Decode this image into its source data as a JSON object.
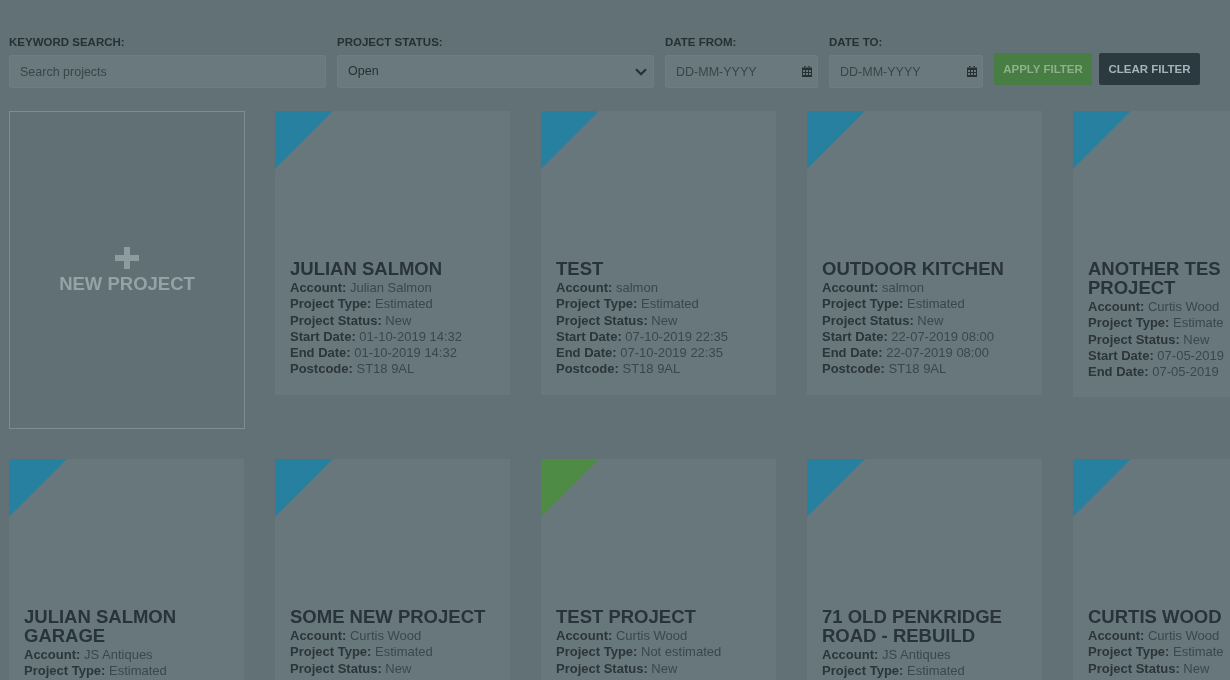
{
  "filters": {
    "keyword": {
      "label": "KEYWORD SEARCH:",
      "placeholder": "Search projects"
    },
    "status": {
      "label": "PROJECT STATUS:",
      "value": "Open"
    },
    "date_from": {
      "label": "DATE FROM:",
      "placeholder": "DD-MM-YYYY"
    },
    "date_to": {
      "label": "DATE TO:",
      "placeholder": "DD-MM-YYYY"
    },
    "buttons": [
      {
        "label": "APPLY FILTER",
        "kind": "apply"
      },
      {
        "label": "CLEAR FILTER",
        "kind": "clear"
      }
    ]
  },
  "new_project": {
    "label": "NEW PROJECT"
  },
  "projects": [
    {
      "title": "JULIAN SALMON",
      "color": "#27809f",
      "details": [
        {
          "label": "Account:",
          "value": "Julian Salmon"
        },
        {
          "label": "Project Type:",
          "value": "Estimated"
        },
        {
          "label": "Project Status:",
          "value": "New"
        },
        {
          "label": "Start Date:",
          "value": "01-10-2019 14:32"
        },
        {
          "label": "End Date:",
          "value": "01-10-2019 14:32"
        },
        {
          "label": "Postcode:",
          "value": "ST18 9AL"
        }
      ]
    },
    {
      "title": "TEST",
      "color": "#27809f",
      "details": [
        {
          "label": "Account:",
          "value": "salmon"
        },
        {
          "label": "Project Type:",
          "value": "Estimated"
        },
        {
          "label": "Project Status:",
          "value": "New"
        },
        {
          "label": "Start Date:",
          "value": "07-10-2019 22:35"
        },
        {
          "label": "End Date:",
          "value": "07-10-2019 22:35"
        },
        {
          "label": "Postcode:",
          "value": "ST18 9AL"
        }
      ]
    },
    {
      "title": "OUTDOOR KITCHEN",
      "color": "#27809f",
      "details": [
        {
          "label": "Account:",
          "value": "salmon"
        },
        {
          "label": "Project Type:",
          "value": "Estimated"
        },
        {
          "label": "Project Status:",
          "value": "New"
        },
        {
          "label": "Start Date:",
          "value": "22-07-2019 08:00"
        },
        {
          "label": "End Date:",
          "value": "22-07-2019 08:00"
        },
        {
          "label": "Postcode:",
          "value": "ST18 9AL"
        }
      ]
    },
    {
      "title": "ANOTHER TES PROJECT",
      "color": "#27809f",
      "details": [
        {
          "label": "Account:",
          "value": "Curtis Wood"
        },
        {
          "label": "Project Type:",
          "value": "Estimate"
        },
        {
          "label": "Project Status:",
          "value": "New"
        },
        {
          "label": "Start Date:",
          "value": "07-05-2019"
        },
        {
          "label": "End Date:",
          "value": "07-05-2019"
        }
      ]
    },
    {
      "title": "JULIAN SALMON GARAGE",
      "color": "#27809f",
      "details": [
        {
          "label": "Account:",
          "value": "JS Antiques"
        },
        {
          "label": "Project Type:",
          "value": "Estimated"
        }
      ]
    },
    {
      "title": "SOME NEW PROJECT",
      "color": "#27809f",
      "details": [
        {
          "label": "Account:",
          "value": "Curtis Wood"
        },
        {
          "label": "Project Type:",
          "value": "Estimated"
        },
        {
          "label": "Project Status:",
          "value": "New"
        }
      ]
    },
    {
      "title": "TEST PROJECT",
      "color": "#4e8b45",
      "details": [
        {
          "label": "Account:",
          "value": "Curtis Wood"
        },
        {
          "label": "Project Type:",
          "value": "Not estimated"
        },
        {
          "label": "Project Status:",
          "value": "New"
        }
      ]
    },
    {
      "title": "71 OLD PENKRIDGE ROAD - REBUILD",
      "color": "#27809f",
      "details": [
        {
          "label": "Account:",
          "value": "JS Antiques"
        },
        {
          "label": "Project Type:",
          "value": "Estimated"
        }
      ]
    },
    {
      "title": "CURTIS WOOD",
      "color": "#27809f",
      "details": [
        {
          "label": "Account:",
          "value": "Curtis Wood"
        },
        {
          "label": "Project Type:",
          "value": "Estimate"
        },
        {
          "label": "Project Status:",
          "value": "New"
        }
      ]
    }
  ]
}
